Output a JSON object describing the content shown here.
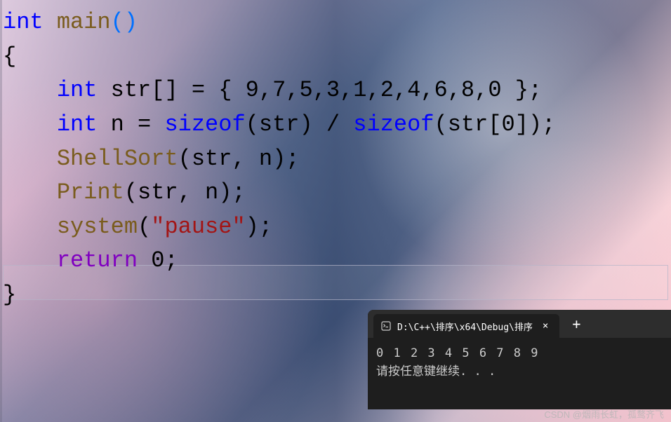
{
  "code": {
    "line1_kw": "int",
    "line1_fn": " main",
    "line1_paren": "()",
    "line2": "{",
    "line3_indent": "    ",
    "line3_kw": "int",
    "line3_var": " str[] = { 9,7,5,3,1,2,4,6,8,0 };",
    "line4_indent": "    ",
    "line4_kw": "int",
    "line4_var": " n = ",
    "line4_sizeof1": "sizeof",
    "line4_p1": "(str) / ",
    "line4_sizeof2": "sizeof",
    "line4_p2": "(str[0]);",
    "line5_indent": "    ",
    "line5_fn": "ShellSort",
    "line5_args": "(str, n);",
    "line6_indent": "    ",
    "line6_fn": "Print",
    "line6_args": "(str, n);",
    "line7_indent": "    ",
    "line7_fn": "system",
    "line7_p1": "(",
    "line7_str": "\"pause\"",
    "line7_p2": ");",
    "line8_indent": "    ",
    "line8_kw": "return",
    "line8_val": " 0;",
    "line9": "}"
  },
  "terminal": {
    "title": "D:\\C++\\排序\\x64\\Debug\\排序",
    "output": "0 1 2 3 4 5 6 7 8 9",
    "prompt": "请按任意键继续. . .",
    "close": "×",
    "newtab": "+"
  },
  "watermark": "CSDN @烟雨长虹，孤鹜齐飞"
}
